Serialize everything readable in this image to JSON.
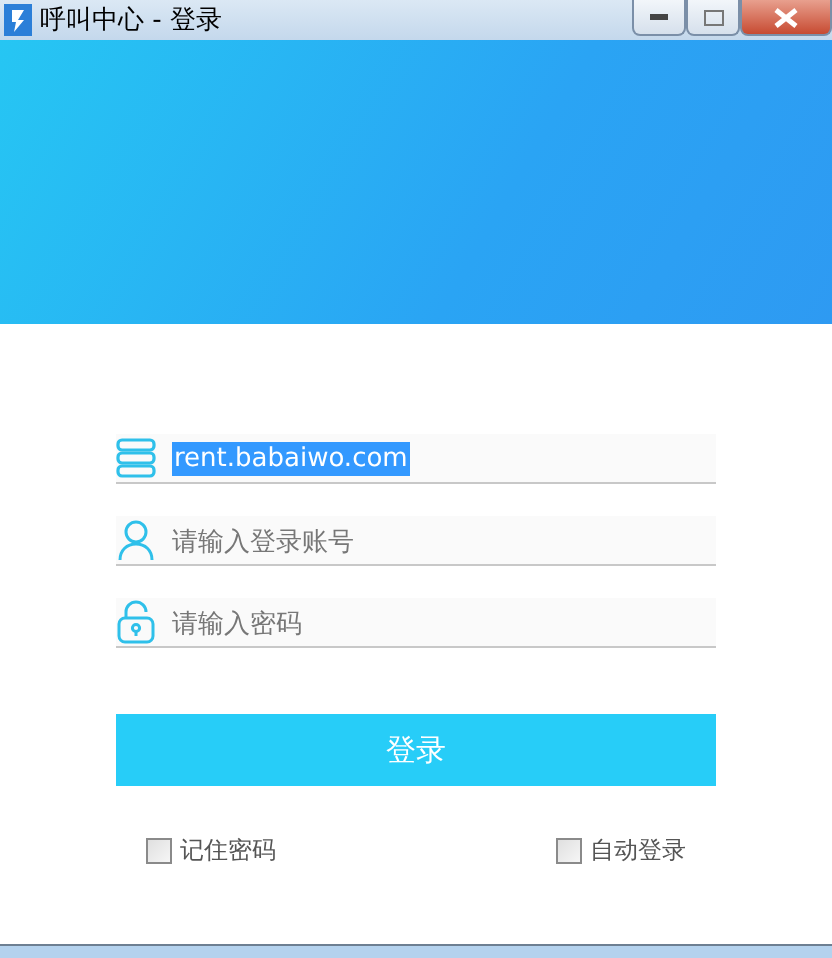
{
  "window": {
    "title": "呼叫中心 - 登录"
  },
  "server": {
    "value": "rent.babaiwo.com",
    "selected": true
  },
  "account": {
    "placeholder": "请输入登录账号"
  },
  "password": {
    "placeholder": "请输入密码"
  },
  "login_button": "登录",
  "options": [
    {
      "label": "记住密码",
      "checked": false
    },
    {
      "label": "自动登录",
      "checked": false
    }
  ]
}
